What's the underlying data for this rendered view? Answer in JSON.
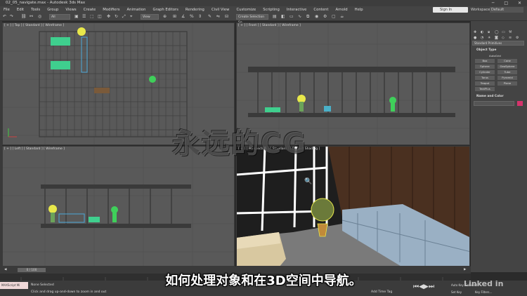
{
  "window": {
    "title": "02_05_navigate.max - Autodesk 3ds Max",
    "controls": "─ □ ✕"
  },
  "menu": {
    "items": [
      "File",
      "Edit",
      "Tools",
      "Group",
      "Views",
      "Create",
      "Modifiers",
      "Animation",
      "Graph Editors",
      "Rendering",
      "Civil View",
      "Customize",
      "Scripting",
      "Interactive",
      "Content",
      "Arnold",
      "Help"
    ],
    "signin": "Sign In",
    "workspaces_label": "Workspaces:",
    "workspace_value": "Default"
  },
  "toolbar": {
    "filter_value": "All",
    "refcoord_value": "View",
    "named_selection": "Create Selection Se"
  },
  "viewports": {
    "top": "[ + ] [ Top ] [ Standard ] [ Wireframe ]",
    "front": "[ + ] [ Front ] [ Standard ] [ Wireframe ]",
    "left": "[ + ] [ Left ] [ Standard ] [ Wireframe ]",
    "persp": "[ + ] [ Perspective ] [ Standard ] [ Default Shading ]"
  },
  "command_panel": {
    "dropdown": "Standard Primitives",
    "object_type_header": "Object Type",
    "autogrid": "AutoGrid",
    "buttons": [
      "Box",
      "Cone",
      "Sphere",
      "GeoSphere",
      "Cylinder",
      "Tube",
      "Torus",
      "Pyramid",
      "Teapot",
      "Plane",
      "TextPlus"
    ],
    "name_color_header": "Name and Color",
    "accent": "#d6336c"
  },
  "timeline": {
    "frame": "0 / 100"
  },
  "status": {
    "maxscript": "MAXScript Mi",
    "none_selected": "None Selected",
    "prompt": "Click and drag up-and-down to zoom in and out",
    "add_time_tag": "Add Time Tag",
    "auto_key": "Auto Key",
    "set_key": "Set Key",
    "selected": "Selected",
    "key_filters": "Key Filters..."
  },
  "overlay": {
    "subtitle": "如何处理对象和在3D空间中导航。",
    "watermark": "永远的CG",
    "brand": "Linked in"
  }
}
